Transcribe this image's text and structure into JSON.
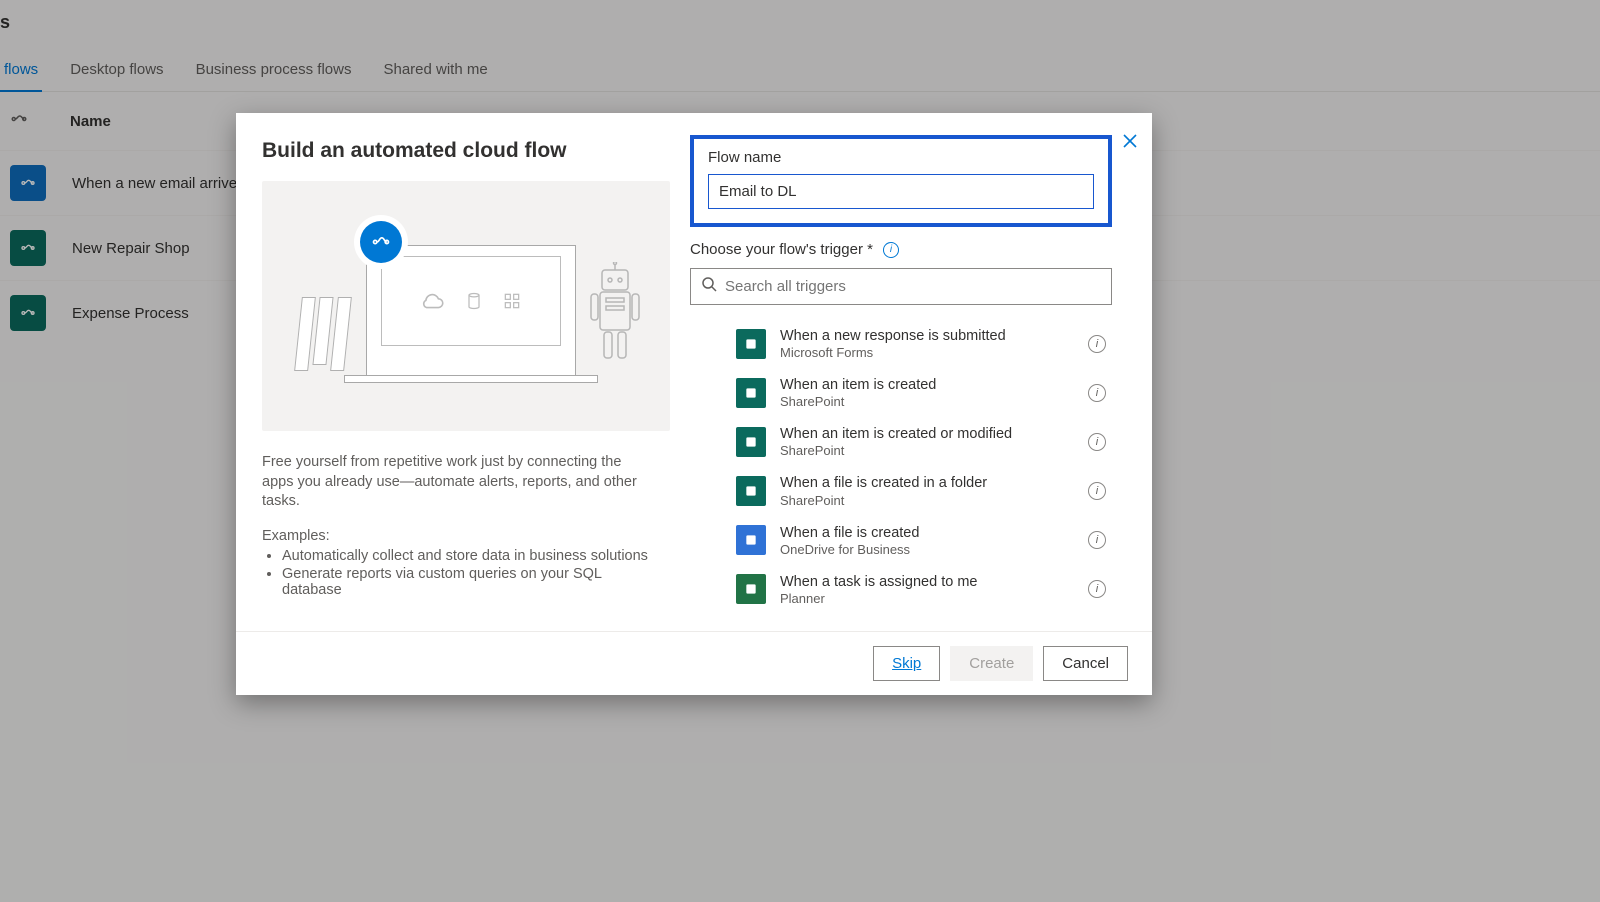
{
  "page": {
    "header_suffix": "s",
    "tabs": [
      "flows",
      "Desktop flows",
      "Business process flows",
      "Shared with me"
    ],
    "table_header": {
      "name_col": "Name"
    },
    "flows": [
      {
        "name": "When a new email arrives",
        "icon_color": "#0f6cbd"
      },
      {
        "name": "New Repair Shop",
        "icon_color": "#0b6a5d"
      },
      {
        "name": "Expense Process",
        "icon_color": "#0b6a5d"
      }
    ]
  },
  "dialog": {
    "title": "Build an automated cloud flow",
    "description": "Free yourself from repetitive work just by connecting the apps you already use—automate alerts, reports, and other tasks.",
    "examples_header": "Examples:",
    "examples": [
      "Automatically collect and store data in business solutions",
      "Generate reports via custom queries on your SQL database"
    ],
    "flow_name_label": "Flow name",
    "flow_name_value": "Email to DL",
    "trigger_label": "Choose your flow's trigger *",
    "search_placeholder": "Search all triggers",
    "triggers": [
      {
        "title": "When a new response is submitted",
        "sub": "Microsoft Forms",
        "color": "#0b6a5d"
      },
      {
        "title": "When an item is created",
        "sub": "SharePoint",
        "color": "#0b6a5d"
      },
      {
        "title": "When an item is created or modified",
        "sub": "SharePoint",
        "color": "#0b6a5d"
      },
      {
        "title": "When a file is created in a folder",
        "sub": "SharePoint",
        "color": "#0b6a5d"
      },
      {
        "title": "When a file is created",
        "sub": "OneDrive for Business",
        "color": "#2f72d6"
      },
      {
        "title": "When a task is assigned to me",
        "sub": "Planner",
        "color": "#217346"
      }
    ],
    "footer": {
      "skip": "Skip",
      "create": "Create",
      "cancel": "Cancel"
    }
  }
}
